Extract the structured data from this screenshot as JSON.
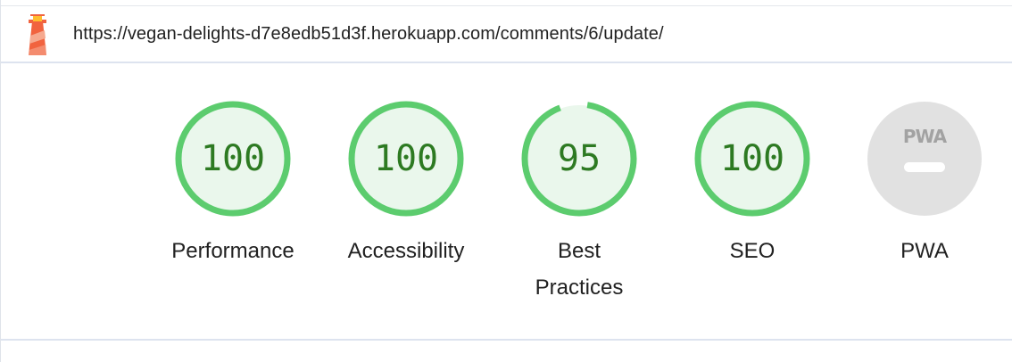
{
  "report": {
    "url": "https://vegan-delights-d7e8edb51d3f.herokuapp.com/comments/6/update/",
    "icon": "lighthouse-icon"
  },
  "categories": [
    {
      "label": "Performance",
      "score": "100",
      "fraction": 1.0
    },
    {
      "label": "Accessibility",
      "score": "100",
      "fraction": 1.0
    },
    {
      "label": "Best Practices",
      "score": "95",
      "fraction": 0.95
    },
    {
      "label": "SEO",
      "score": "100",
      "fraction": 1.0
    }
  ],
  "pwa": {
    "label": "PWA",
    "badge_text": "PWA",
    "icon": "pwa-badge-icon"
  },
  "colors": {
    "pass_ring": "#5ccc6e",
    "pass_fill": "#eaf7ec",
    "pass_text": "#2d7a22",
    "na_fill": "#e1e1e1"
  }
}
